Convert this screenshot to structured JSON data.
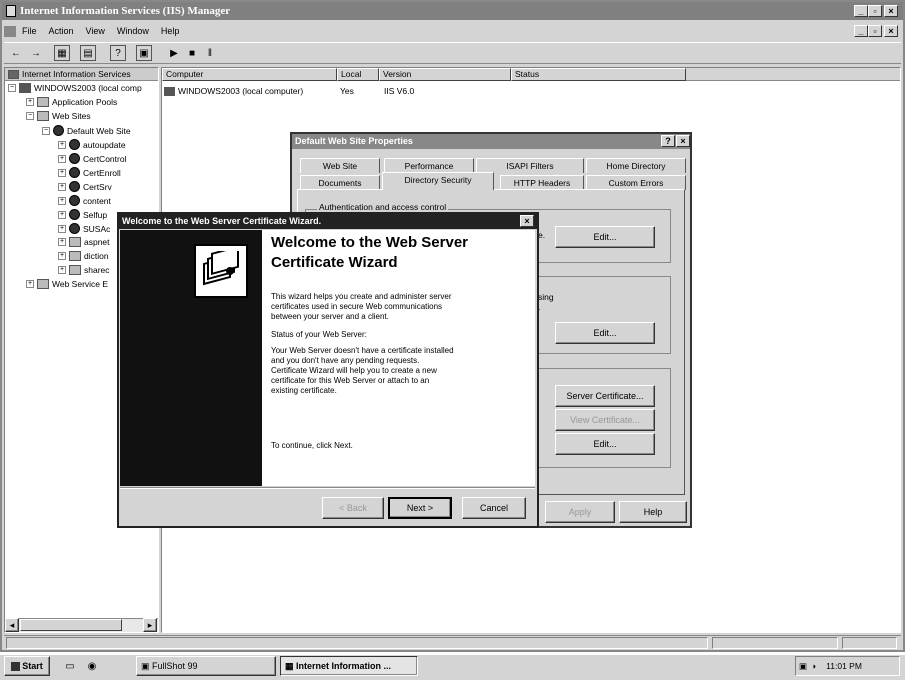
{
  "window": {
    "title": "Internet Information Services (IIS) Manager"
  },
  "menu": {
    "file": "File",
    "action": "Action",
    "view": "View",
    "window": "Window",
    "help": "Help"
  },
  "tree": {
    "root": "Internet Information Services",
    "computer": "WINDOWS2003 (local comp",
    "app_pools": "Application Pools",
    "web_sites": "Web Sites",
    "default_site": "Default Web Site",
    "children": [
      "autoupdate",
      "CertControl",
      "CertEnroll",
      "CertSrv",
      "content",
      "Selfup",
      "SUSAc",
      "aspnet",
      "diction",
      "sharec"
    ],
    "web_service_ext": "Web Service E"
  },
  "list": {
    "columns": [
      "Computer",
      "Local",
      "Version",
      "Status"
    ],
    "row": {
      "computer": "WINDOWS2003 (local computer)",
      "local": "Yes",
      "version": "IIS V6.0",
      "status": ""
    }
  },
  "props": {
    "title": "Default Web Site Properties",
    "tabs_row1": [
      "Web Site",
      "Performance",
      "ISAPI Filters",
      "Home Directory"
    ],
    "tabs_row2": [
      "Documents",
      "Directory Security",
      "HTTP Headers",
      "Custom Errors"
    ],
    "group1": "Authentication and access control",
    "frag1": "e.",
    "frag2": "sing",
    "frag3": ".",
    "edit1": "Edit...",
    "edit2": "Edit...",
    "server_cert": "Server Certificate...",
    "view_cert": "View Certificate...",
    "edit3": "Edit...",
    "apply": "Apply",
    "help": "Help"
  },
  "wizard": {
    "title": "Welcome to the Web Server Certificate Wizard.",
    "heading1": "Welcome to the Web Server",
    "heading2": "Certificate Wizard",
    "intro1": "This wizard helps you create and administer server",
    "intro2": "certificates used in secure Web communications",
    "intro3": "between your server and a client.",
    "status_label": "Status of your Web Server:",
    "status1": "Your Web Server doesn't have a certificate installed",
    "status2": "and you don't have any pending requests.",
    "status3": "Certificate Wizard will help you to create a new",
    "status4": "certificate for this Web Server or attach to an",
    "status5": "existing certificate.",
    "continue": "To continue, click Next.",
    "back": "< Back",
    "next": "Next >",
    "cancel": "Cancel"
  },
  "taskbar": {
    "start": "Start",
    "task1": "FullShot 99",
    "task2": "Internet Information ...",
    "clock": "11:01 PM"
  }
}
